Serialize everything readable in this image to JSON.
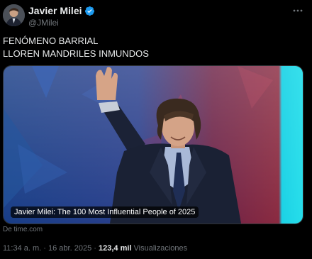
{
  "post": {
    "author": {
      "display_name": "Javier Milei",
      "handle": "@JMilei",
      "verified_icon": "verified-badge-icon"
    },
    "more_icon": "more-options-icon",
    "text": {
      "line1": "FENÓMENO BARRIAL",
      "line2": "LLOREN MANDRILES INMUNDOS"
    },
    "card": {
      "title": "Javier Milei: The 100 Most Influential People of 2025",
      "source": "De time.com"
    },
    "meta": {
      "time": "11:34 a. m.",
      "separator": "·",
      "date": "16 abr. 2025",
      "views_count": "123,4 mil",
      "views_label": "Visualizaciones"
    }
  },
  "colors": {
    "background": "#000000",
    "text_primary": "#e7e9ea",
    "text_secondary": "#71767b",
    "verified": "#1d9bf0",
    "card_stage_blue": "#1f4f9c",
    "card_stage_red": "#7a1f3a",
    "card_cyan": "#1fd8e8"
  }
}
